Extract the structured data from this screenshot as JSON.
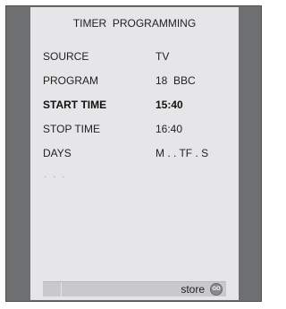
{
  "menu": {
    "title": "TIMER  PROGRAMMING",
    "rows": [
      {
        "label": "SOURCE",
        "value": "TV",
        "active": false
      },
      {
        "label": "PROGRAM",
        "value": "18  BBC",
        "active": false
      },
      {
        "label": "START TIME",
        "value": "15:40",
        "active": true
      },
      {
        "label": "STOP TIME",
        "value": "16:40",
        "active": false
      },
      {
        "label": "DAYS",
        "value": "M . . TF . S",
        "active": false
      }
    ],
    "more_indicator": "· · ·"
  },
  "footer": {
    "store_label": "store",
    "go_icon_text": "GO"
  },
  "colors": {
    "frame": "#6e6f71",
    "screen": "#e6e6e8",
    "bar": "#c9c9cb",
    "text": "#222222"
  }
}
